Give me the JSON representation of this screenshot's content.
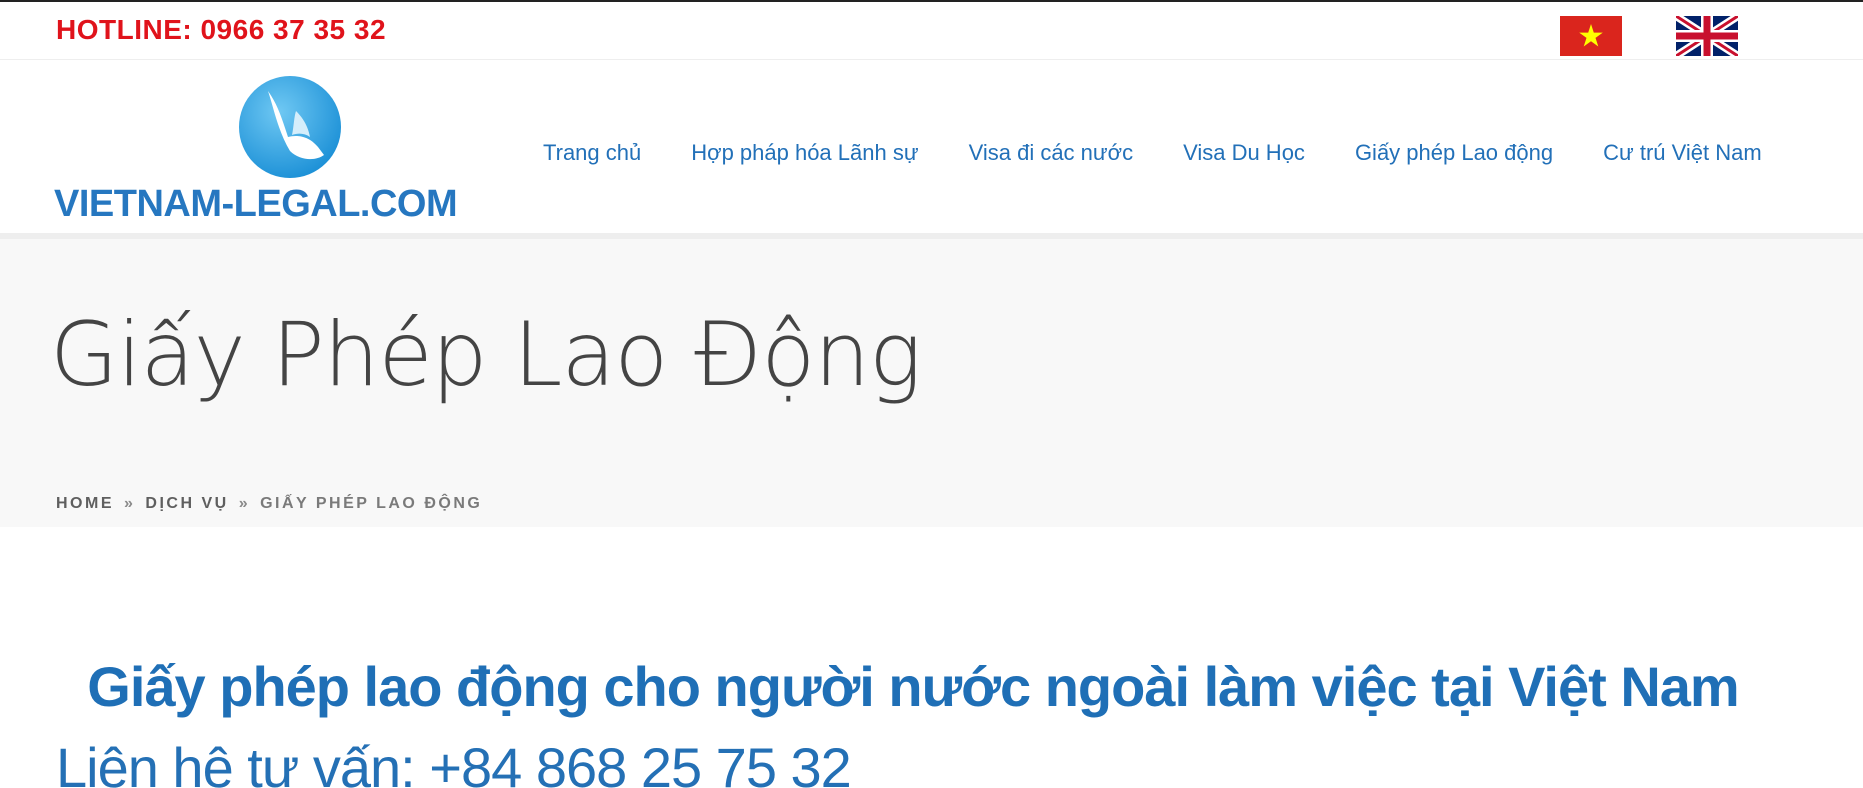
{
  "topbar": {
    "hotline": "HOTLINE: 0966 37 35 32",
    "languages": [
      {
        "code": "vi",
        "icon": "vietnam-flag-icon"
      },
      {
        "code": "en",
        "icon": "uk-flag-icon"
      }
    ]
  },
  "logo": {
    "text": "VIETNAM-LEGAL.COM",
    "icon": "bird-logo-icon"
  },
  "nav": {
    "items": [
      {
        "label": "Trang chủ"
      },
      {
        "label": "Hợp pháp hóa Lãnh sự"
      },
      {
        "label": "Visa đi các nước"
      },
      {
        "label": "Visa Du Học"
      },
      {
        "label": "Giấy phép Lao động",
        "active": true
      },
      {
        "label": "Cư trú Việt Nam"
      }
    ]
  },
  "page": {
    "title": "Giấy Phép Lao Động",
    "breadcrumb": {
      "home": "HOME",
      "sep": "»",
      "parent": "DỊCH VỤ",
      "current": "GIẤY PHÉP LAO ĐỘNG"
    }
  },
  "content": {
    "heading": "Giấy phép lao động cho người nước ngoài làm việc tại Việt Nam",
    "contact": "Liên hệ tư vấn: +84 868 25 75 32"
  },
  "colors": {
    "hotline": "#e0131b",
    "brand_blue": "#2676bb",
    "band_bg": "#f8f8f8"
  }
}
